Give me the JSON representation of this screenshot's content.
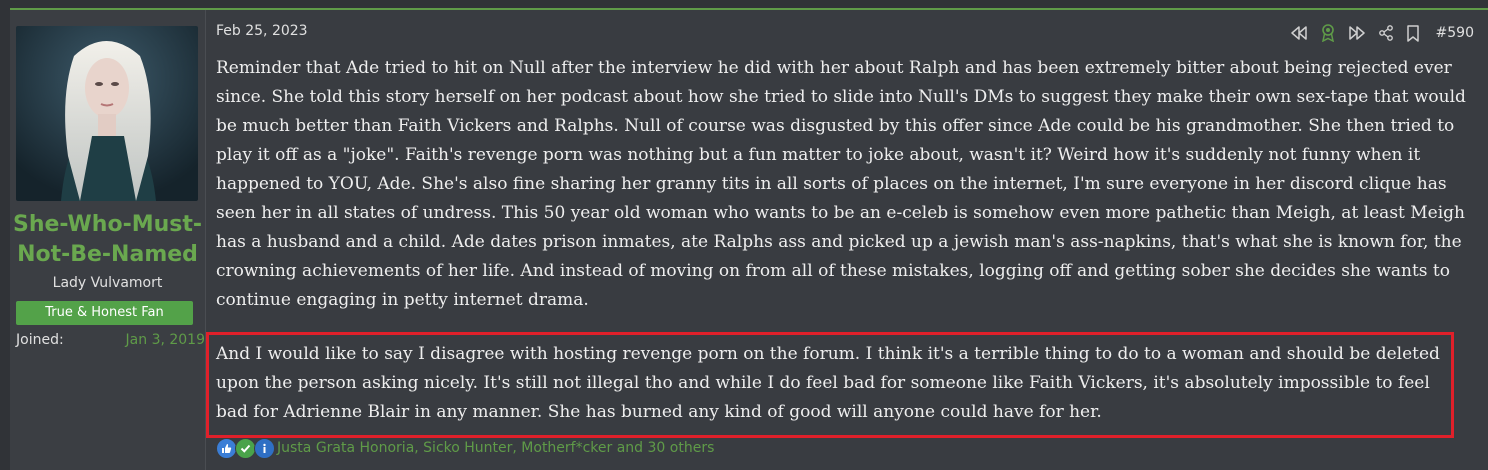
{
  "user": {
    "name": "She-Who-Must-Not-Be-Named",
    "title": "Lady Vulvamort",
    "banner": "True & Honest Fan",
    "joined_label": "Joined:",
    "joined_value": "Jan 3, 2019"
  },
  "post": {
    "date": "Feb 25, 2023",
    "number": "#590",
    "paragraph1": "Reminder that Ade tried to hit on Null after the interview he did with her about Ralph and has been extremely bitter about being rejected ever since. She told this story herself on her podcast about how she tried to slide into Null's DMs to suggest they make their own sex-tape that would be much better than Faith Vickers and Ralphs. Null of course was disgusted by this offer since Ade could be his grandmother. She then tried to play it off as a \"joke\". Faith's revenge porn was nothing but a fun matter to joke about, wasn't it? Weird how it's suddenly not funny when it happened to YOU, Ade. She's also fine sharing her granny tits in all sorts of places on the internet, I'm sure everyone in her discord clique has seen her in all states of undress. This 50 year old woman who wants to be an e-celeb is somehow even more pathetic than Meigh, at least Meigh has a husband and a child. Ade dates prison inmates, ate Ralphs ass and picked up a jewish man's ass-napkins, that's what she is known for, the crowning achievements of her life. And instead of moving on from all of these mistakes, logging off and getting sober she decides she wants to continue engaging in petty internet drama.",
    "paragraph2": "And I would like to say I disagree with hosting revenge porn on the forum. I think it's a terrible thing to do to a woman and should be deleted upon the person asking nicely. It's still not illegal tho and while I do feel bad for someone like Faith Vickers, it's absolutely impossible to feel bad for Adrienne Blair in any manner. She has burned any kind of good will anyone could have for her."
  },
  "reactions": {
    "icons": [
      "thumbs-up-icon",
      "check-icon",
      "info-icon"
    ],
    "text": "Justa Grata Honoria, Sicko Hunter, Motherf*cker and 30 others"
  },
  "colors": {
    "accent_green": "#5f9b48",
    "banner_green": "#53a249",
    "highlight_red": "#e0202a",
    "background": "#393c41"
  }
}
